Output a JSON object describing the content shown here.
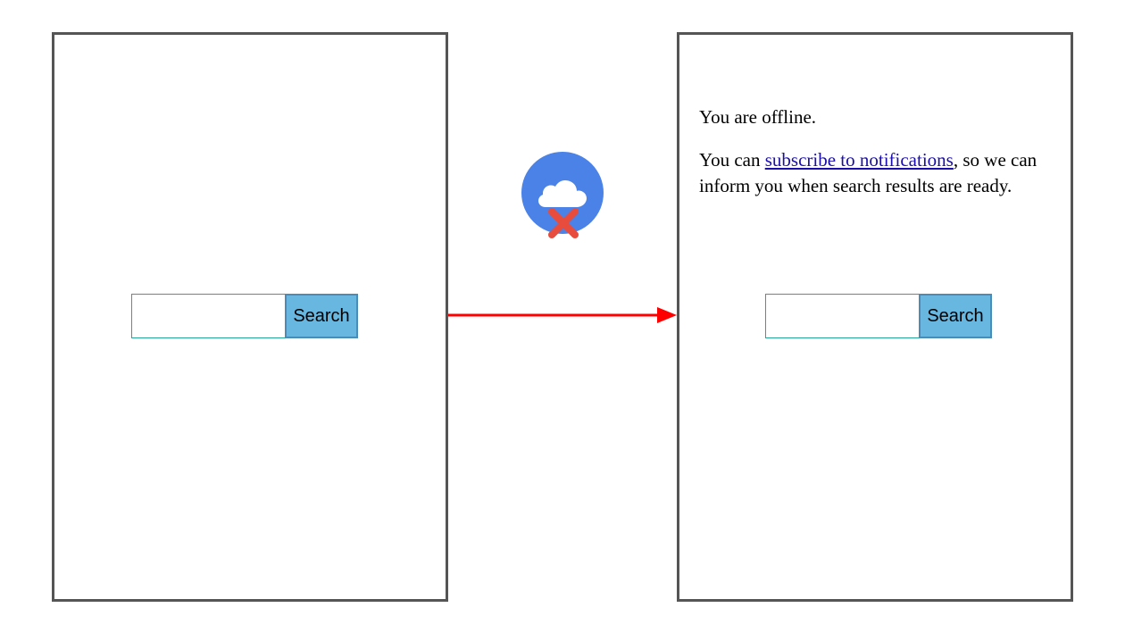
{
  "left": {
    "search_button": "Search",
    "search_value": ""
  },
  "right": {
    "offline_line1": "You are offline.",
    "offline_prefix": "You can ",
    "offline_link": "subscribe to notifications",
    "offline_suffix": ", so we can inform you when search results are ready.",
    "search_button": "Search",
    "search_value": ""
  },
  "icons": {
    "cloud": "cloud-icon",
    "cross": "cross-icon",
    "arrow": "right-arrow"
  },
  "colors": {
    "panel_border": "#555555",
    "input_border": "#26a69a",
    "button_bg": "#67b7e1",
    "button_border": "#4a8bb8",
    "cloud_bg": "#4a82e8",
    "cross": "#e74c3c",
    "arrow": "#ff0000",
    "link": "#1a0dab"
  }
}
